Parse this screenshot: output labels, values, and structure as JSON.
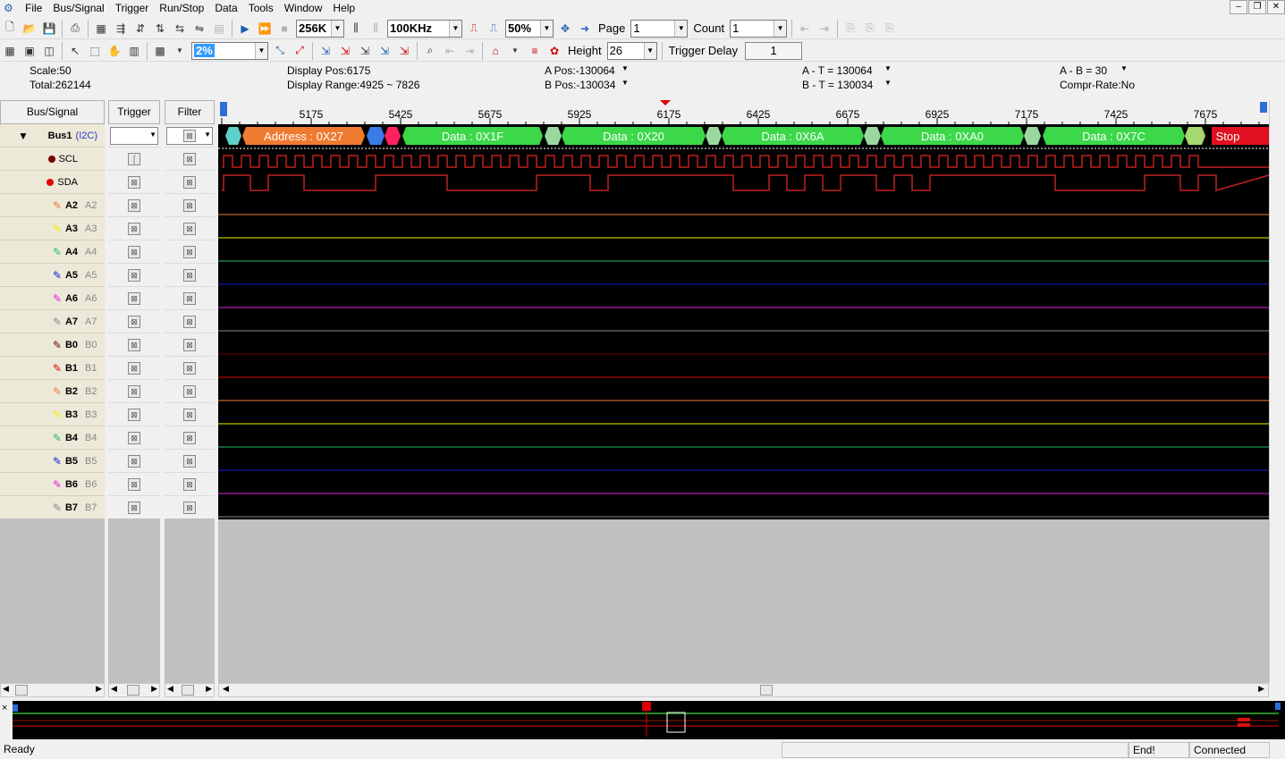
{
  "menu": [
    "File",
    "Bus/Signal",
    "Trigger",
    "Run/Stop",
    "Data",
    "Tools",
    "Window",
    "Help"
  ],
  "toolbar": {
    "depth": "256K",
    "sample_rate": "100KHz",
    "trigger_pos": "50%",
    "page_label": "Page",
    "page_value": "1",
    "count_label": "Count",
    "count_value": "1",
    "zoom": "2%",
    "height_label": "Height",
    "height_value": "26",
    "trigger_delay_label": "Trigger Delay",
    "trigger_delay_value": "1"
  },
  "info": {
    "scale": "Scale:50",
    "total": "Total:262144",
    "display_pos": "Display Pos:6175",
    "display_range": "Display Range:4925 ~ 7826",
    "a_pos": "A Pos:-130064",
    "b_pos": "B Pos:-130034",
    "a_t": "A - T = 130064",
    "b_t": "B - T = 130034",
    "a_b": "A - B = 30",
    "compr": "Compr-Rate:No"
  },
  "headers": {
    "bus_signal": "Bus/Signal",
    "trigger": "Trigger",
    "filter": "Filter"
  },
  "bus": {
    "name": "Bus1",
    "type": "(I2C)"
  },
  "signals": [
    {
      "name": "SCL",
      "sub": "",
      "color": "#7b0000",
      "kind": "dot"
    },
    {
      "name": "SDA",
      "sub": "",
      "color": "#e00000",
      "kind": "dot"
    },
    {
      "name": "A2",
      "sub": "A2",
      "color": "#f07a3a",
      "kind": "pen"
    },
    {
      "name": "A3",
      "sub": "A3",
      "color": "#f0f000",
      "kind": "pen"
    },
    {
      "name": "A4",
      "sub": "A4",
      "color": "#20c060",
      "kind": "pen"
    },
    {
      "name": "A5",
      "sub": "A5",
      "color": "#1020d0",
      "kind": "pen"
    },
    {
      "name": "A6",
      "sub": "A6",
      "color": "#e020e0",
      "kind": "pen"
    },
    {
      "name": "A7",
      "sub": "A7",
      "color": "#888888",
      "kind": "pen"
    },
    {
      "name": "B0",
      "sub": "B0",
      "color": "#700000",
      "kind": "pen"
    },
    {
      "name": "B1",
      "sub": "B1",
      "color": "#e00000",
      "kind": "pen"
    },
    {
      "name": "B2",
      "sub": "B2",
      "color": "#f07a3a",
      "kind": "pen"
    },
    {
      "name": "B3",
      "sub": "B3",
      "color": "#f0f000",
      "kind": "pen"
    },
    {
      "name": "B4",
      "sub": "B4",
      "color": "#20c060",
      "kind": "pen"
    },
    {
      "name": "B5",
      "sub": "B5",
      "color": "#1020d0",
      "kind": "pen"
    },
    {
      "name": "B6",
      "sub": "B6",
      "color": "#e020e0",
      "kind": "pen"
    },
    {
      "name": "B7",
      "sub": "B7",
      "color": "#888888",
      "kind": "pen"
    }
  ],
  "ruler": {
    "ticks": [
      "5175",
      "5425",
      "5675",
      "5925",
      "6175",
      "6425",
      "6675",
      "6925",
      "7175",
      "7425",
      "7675"
    ]
  },
  "decode": [
    {
      "label": "Address : 0X27",
      "color": "#f07a30"
    },
    {
      "label": "Data : 0X1F",
      "color": "#3cd84a"
    },
    {
      "label": "Data : 0X20",
      "color": "#3cd84a"
    },
    {
      "label": "Data : 0X6A",
      "color": "#3cd84a"
    },
    {
      "label": "Data : 0XA0",
      "color": "#3cd84a"
    },
    {
      "label": "Data : 0X7C",
      "color": "#3cd84a"
    },
    {
      "label": "Stop",
      "color": "#e01020"
    }
  ],
  "status": {
    "ready": "Ready",
    "end": "End!",
    "connected": "Connected"
  }
}
